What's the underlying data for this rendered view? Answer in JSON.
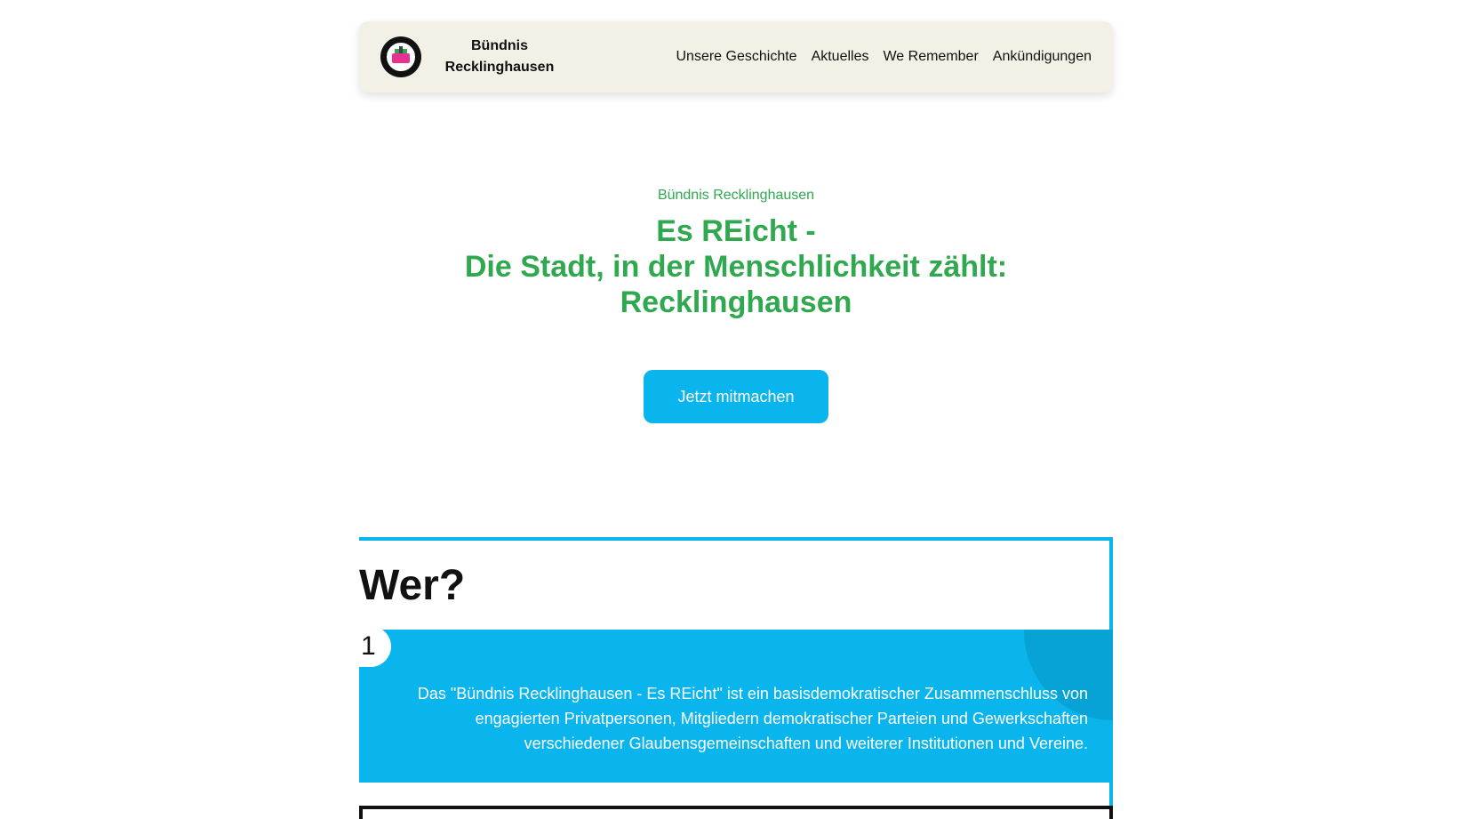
{
  "header": {
    "brand_name": "Bündnis Recklinghausen",
    "nav": [
      {
        "label": "Unsere Geschichte"
      },
      {
        "label": "Aktuelles"
      },
      {
        "label": "We Remember"
      },
      {
        "label": "Ankündigungen"
      }
    ]
  },
  "hero": {
    "eyebrow": "Bündnis Recklinghausen",
    "title_line1": "Es REicht -",
    "title_line2": "Die Stadt, in der Menschlichkeit zählt:",
    "title_line3": "Recklinghausen",
    "cta_label": "Jetzt mitmachen"
  },
  "wer": {
    "heading": "Wer?",
    "number": "1",
    "text": "Das \"Bündnis Recklinghausen - Es REicht\" ist ein basisdemokratischer Zusammenschluss von engagierten Privatpersonen, Mitgliedern demokratischer Parteien und Gewerkschaften verschiedener Glaubensgemeinschaften und weiterer Institutionen und Vereine."
  },
  "colors": {
    "accent_green": "#2fa84f",
    "accent_blue": "#0ab4ec",
    "nav_background": "#f3f0e6"
  }
}
